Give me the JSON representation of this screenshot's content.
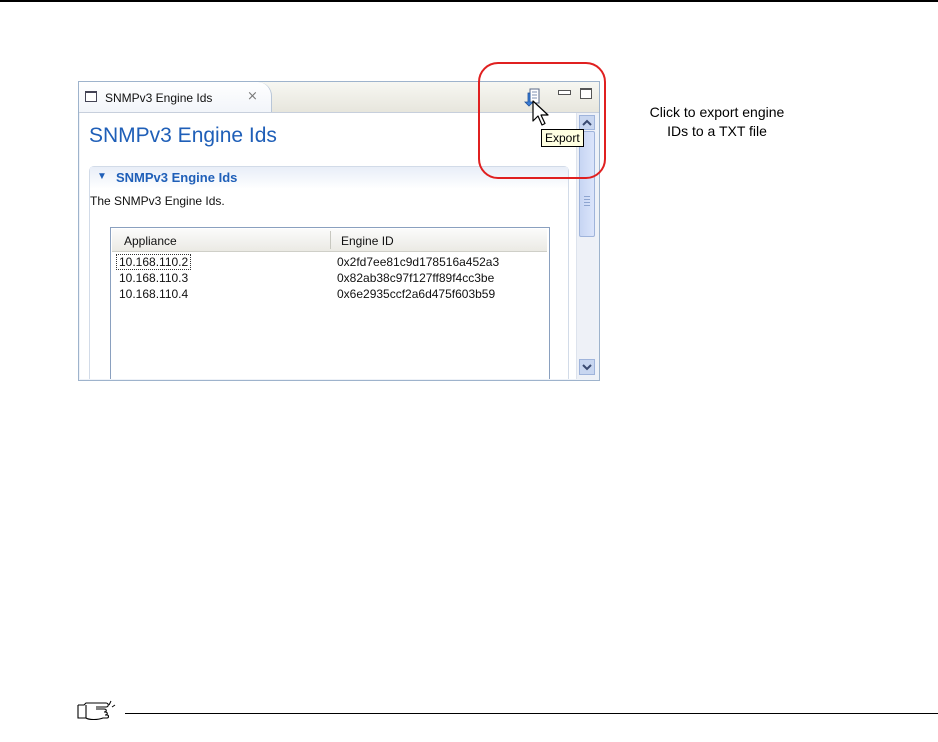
{
  "view": {
    "tab_label": "SNMPv3 Engine Ids",
    "tab_close_icon": "close-icon",
    "toolbar": {
      "export_icon": "export-icon",
      "minimize_icon": "minimize-icon",
      "maximize_icon": "maximize-icon",
      "export_tooltip": "Export"
    },
    "form_title": "SNMPv3 Engine Ids",
    "section": {
      "title": "SNMPv3 Engine Ids",
      "description": "The SNMPv3 Engine Ids.",
      "expanded": true
    },
    "table": {
      "columns": [
        "Appliance",
        "Engine ID"
      ],
      "rows": [
        [
          "10.168.110.2",
          "0x2fd7ee81c9d178516a452a3"
        ],
        [
          "10.168.110.3",
          "0x82ab38c97f127ff89f4cc3be"
        ],
        [
          "10.168.110.4",
          "0x6e2935ccf2a6d475f603b59"
        ]
      ]
    }
  },
  "annotation": {
    "line1": "Click to export engine",
    "line2": "IDs to a TXT  file",
    "highlight_color": "#e02020"
  },
  "colors": {
    "title_blue": "#1f5fb8",
    "panel_border": "#9eb3cc",
    "tooltip_bg": "#ffffe1"
  }
}
